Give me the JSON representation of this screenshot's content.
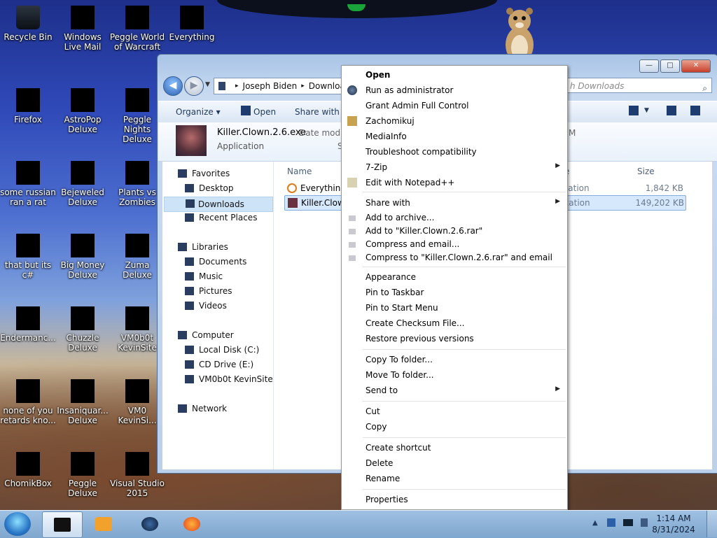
{
  "desktop": {
    "icons": [
      {
        "label": "Recycle Bin",
        "icon": "recycle-bin-icon"
      },
      {
        "label": "Windows Live Mail",
        "icon": "mail-icon"
      },
      {
        "label": "Peggle World of Warcraft",
        "icon": "peggle-wow-icon"
      },
      {
        "label": "Everything",
        "icon": "everything-icon"
      },
      {
        "label": "Firefox",
        "icon": "firefox-icon"
      },
      {
        "label": "AstroPop Deluxe",
        "icon": "astropop-icon"
      },
      {
        "label": "Peggle Nights Deluxe",
        "icon": "peggle-nights-icon"
      },
      {
        "label": "some russian ran a rat",
        "icon": "app-icon"
      },
      {
        "label": "Bejeweled Deluxe",
        "icon": "bejeweled-icon"
      },
      {
        "label": "Plants vs Zombies",
        "icon": "pvz-icon"
      },
      {
        "label": "that but its c#",
        "icon": "app-icon"
      },
      {
        "label": "Big Money Deluxe",
        "icon": "big-money-icon"
      },
      {
        "label": "Zuma Deluxe",
        "icon": "zuma-icon"
      },
      {
        "label": "Endermanc...",
        "icon": "app-icon"
      },
      {
        "label": "Chuzzle Deluxe",
        "icon": "chuzzle-icon"
      },
      {
        "label": "VM0b0t KevinSite",
        "icon": "vm-icon"
      },
      {
        "label": "none of you retards kno...",
        "icon": "app-icon"
      },
      {
        "label": "Insaniquar... Deluxe",
        "icon": "insaniquarium-icon"
      },
      {
        "label": "VM0 KevinSi...",
        "icon": "vm-icon"
      },
      {
        "label": "ChomikBox",
        "icon": "chomikbox-icon"
      },
      {
        "label": "Peggle Deluxe",
        "icon": "peggle-icon"
      },
      {
        "label": "Visual Studio 2015",
        "icon": "visual-studio-icon"
      }
    ]
  },
  "explorer": {
    "caption_buttons": {
      "minimize": "—",
      "maximize": "□",
      "close": "✕"
    },
    "nav": {
      "back": "◀",
      "forward": "▶",
      "dropdown": "▼"
    },
    "address": {
      "segments": [
        "Joseph Biden",
        "Downloads"
      ]
    },
    "search": {
      "placeholder": "Search Downloads",
      "visible": "h Downloads"
    },
    "toolbar": {
      "organize": "Organize ▾",
      "open": "Open",
      "share_with": "Share with ▾"
    },
    "details": {
      "name": "Killer.Clown.2.6.exe",
      "type": "Application",
      "modified_label": "Date modifi",
      "size_label": "S",
      "time_fragment": "M"
    },
    "navpane": {
      "favorites": "Favorites",
      "desktop": "Desktop",
      "downloads": "Downloads",
      "recent": "Recent Places",
      "libraries": "Libraries",
      "documents": "Documents",
      "music": "Music",
      "pictures": "Pictures",
      "videos": "Videos",
      "computer": "Computer",
      "local_disk": "Local Disk (C:)",
      "cd_drive": "CD Drive (E:)",
      "vm_site": "VM0b0t KevinSite",
      "network": "Network"
    },
    "columns": {
      "name": "Name",
      "type": "e",
      "size": "Size"
    },
    "files": [
      {
        "name": "Everything",
        "type": "lication",
        "size": "1,842 KB"
      },
      {
        "name": "Killer.Clow",
        "type": "lication",
        "size": "149,202 KB"
      }
    ]
  },
  "context_menu": {
    "items": [
      {
        "label": "Open",
        "bold": true
      },
      {
        "label": "Run as administrator",
        "icon": "shield-icon"
      },
      {
        "label": "Grant Admin Full Control"
      },
      {
        "label": "Zachomikuj",
        "icon": "chomik-icon"
      },
      {
        "label": "MediaInfo"
      },
      {
        "label": "Troubleshoot compatibility"
      },
      {
        "label": "7-Zip",
        "submenu": true
      },
      {
        "label": "Edit with Notepad++",
        "icon": "notepadpp-icon"
      },
      {
        "label": "Share with",
        "submenu": true
      },
      {
        "label": "Add to archive...",
        "icon": "archive-icon"
      },
      {
        "label": "Add to \"Killer.Clown.2.6.rar\"",
        "icon": "archive-icon"
      },
      {
        "label": "Compress and email...",
        "icon": "archive-icon"
      },
      {
        "label": "Compress to \"Killer.Clown.2.6.rar\" and email",
        "icon": "archive-icon"
      },
      {
        "label": "Appearance"
      },
      {
        "label": "Pin to Taskbar"
      },
      {
        "label": "Pin to Start Menu"
      },
      {
        "label": "Create Checksum File..."
      },
      {
        "label": "Restore previous versions"
      },
      {
        "label": "Copy To folder..."
      },
      {
        "label": "Move To folder..."
      },
      {
        "label": "Send to",
        "submenu": true
      },
      {
        "label": "Cut"
      },
      {
        "label": "Copy"
      },
      {
        "label": "Create shortcut"
      },
      {
        "label": "Delete"
      },
      {
        "label": "Rename"
      },
      {
        "label": "Properties"
      }
    ],
    "submenu_arrow": "▶"
  },
  "taskbar": {
    "clock_time": "1:14 AM",
    "clock_date": "8/31/2024",
    "tray_arrow": "▲"
  }
}
